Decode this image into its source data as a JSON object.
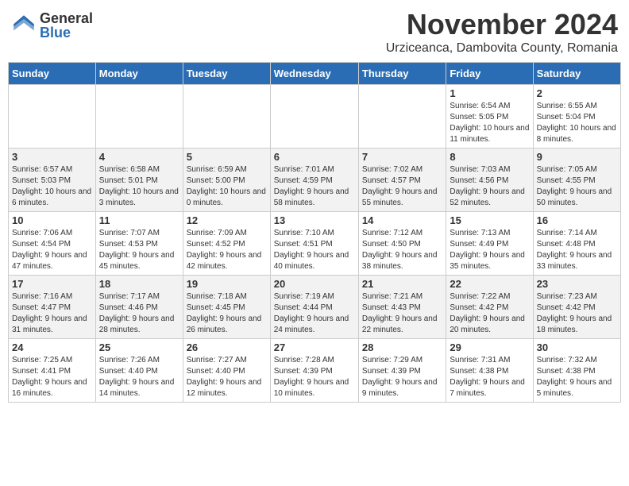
{
  "logo": {
    "general": "General",
    "blue": "Blue"
  },
  "title": "November 2024",
  "subtitle": "Urziceanca, Dambovita County, Romania",
  "days_of_week": [
    "Sunday",
    "Monday",
    "Tuesday",
    "Wednesday",
    "Thursday",
    "Friday",
    "Saturday"
  ],
  "weeks": [
    [
      {
        "day": "",
        "info": ""
      },
      {
        "day": "",
        "info": ""
      },
      {
        "day": "",
        "info": ""
      },
      {
        "day": "",
        "info": ""
      },
      {
        "day": "",
        "info": ""
      },
      {
        "day": "1",
        "info": "Sunrise: 6:54 AM\nSunset: 5:05 PM\nDaylight: 10 hours and 11 minutes."
      },
      {
        "day": "2",
        "info": "Sunrise: 6:55 AM\nSunset: 5:04 PM\nDaylight: 10 hours and 8 minutes."
      }
    ],
    [
      {
        "day": "3",
        "info": "Sunrise: 6:57 AM\nSunset: 5:03 PM\nDaylight: 10 hours and 6 minutes."
      },
      {
        "day": "4",
        "info": "Sunrise: 6:58 AM\nSunset: 5:01 PM\nDaylight: 10 hours and 3 minutes."
      },
      {
        "day": "5",
        "info": "Sunrise: 6:59 AM\nSunset: 5:00 PM\nDaylight: 10 hours and 0 minutes."
      },
      {
        "day": "6",
        "info": "Sunrise: 7:01 AM\nSunset: 4:59 PM\nDaylight: 9 hours and 58 minutes."
      },
      {
        "day": "7",
        "info": "Sunrise: 7:02 AM\nSunset: 4:57 PM\nDaylight: 9 hours and 55 minutes."
      },
      {
        "day": "8",
        "info": "Sunrise: 7:03 AM\nSunset: 4:56 PM\nDaylight: 9 hours and 52 minutes."
      },
      {
        "day": "9",
        "info": "Sunrise: 7:05 AM\nSunset: 4:55 PM\nDaylight: 9 hours and 50 minutes."
      }
    ],
    [
      {
        "day": "10",
        "info": "Sunrise: 7:06 AM\nSunset: 4:54 PM\nDaylight: 9 hours and 47 minutes."
      },
      {
        "day": "11",
        "info": "Sunrise: 7:07 AM\nSunset: 4:53 PM\nDaylight: 9 hours and 45 minutes."
      },
      {
        "day": "12",
        "info": "Sunrise: 7:09 AM\nSunset: 4:52 PM\nDaylight: 9 hours and 42 minutes."
      },
      {
        "day": "13",
        "info": "Sunrise: 7:10 AM\nSunset: 4:51 PM\nDaylight: 9 hours and 40 minutes."
      },
      {
        "day": "14",
        "info": "Sunrise: 7:12 AM\nSunset: 4:50 PM\nDaylight: 9 hours and 38 minutes."
      },
      {
        "day": "15",
        "info": "Sunrise: 7:13 AM\nSunset: 4:49 PM\nDaylight: 9 hours and 35 minutes."
      },
      {
        "day": "16",
        "info": "Sunrise: 7:14 AM\nSunset: 4:48 PM\nDaylight: 9 hours and 33 minutes."
      }
    ],
    [
      {
        "day": "17",
        "info": "Sunrise: 7:16 AM\nSunset: 4:47 PM\nDaylight: 9 hours and 31 minutes."
      },
      {
        "day": "18",
        "info": "Sunrise: 7:17 AM\nSunset: 4:46 PM\nDaylight: 9 hours and 28 minutes."
      },
      {
        "day": "19",
        "info": "Sunrise: 7:18 AM\nSunset: 4:45 PM\nDaylight: 9 hours and 26 minutes."
      },
      {
        "day": "20",
        "info": "Sunrise: 7:19 AM\nSunset: 4:44 PM\nDaylight: 9 hours and 24 minutes."
      },
      {
        "day": "21",
        "info": "Sunrise: 7:21 AM\nSunset: 4:43 PM\nDaylight: 9 hours and 22 minutes."
      },
      {
        "day": "22",
        "info": "Sunrise: 7:22 AM\nSunset: 4:42 PM\nDaylight: 9 hours and 20 minutes."
      },
      {
        "day": "23",
        "info": "Sunrise: 7:23 AM\nSunset: 4:42 PM\nDaylight: 9 hours and 18 minutes."
      }
    ],
    [
      {
        "day": "24",
        "info": "Sunrise: 7:25 AM\nSunset: 4:41 PM\nDaylight: 9 hours and 16 minutes."
      },
      {
        "day": "25",
        "info": "Sunrise: 7:26 AM\nSunset: 4:40 PM\nDaylight: 9 hours and 14 minutes."
      },
      {
        "day": "26",
        "info": "Sunrise: 7:27 AM\nSunset: 4:40 PM\nDaylight: 9 hours and 12 minutes."
      },
      {
        "day": "27",
        "info": "Sunrise: 7:28 AM\nSunset: 4:39 PM\nDaylight: 9 hours and 10 minutes."
      },
      {
        "day": "28",
        "info": "Sunrise: 7:29 AM\nSunset: 4:39 PM\nDaylight: 9 hours and 9 minutes."
      },
      {
        "day": "29",
        "info": "Sunrise: 7:31 AM\nSunset: 4:38 PM\nDaylight: 9 hours and 7 minutes."
      },
      {
        "day": "30",
        "info": "Sunrise: 7:32 AM\nSunset: 4:38 PM\nDaylight: 9 hours and 5 minutes."
      }
    ]
  ]
}
